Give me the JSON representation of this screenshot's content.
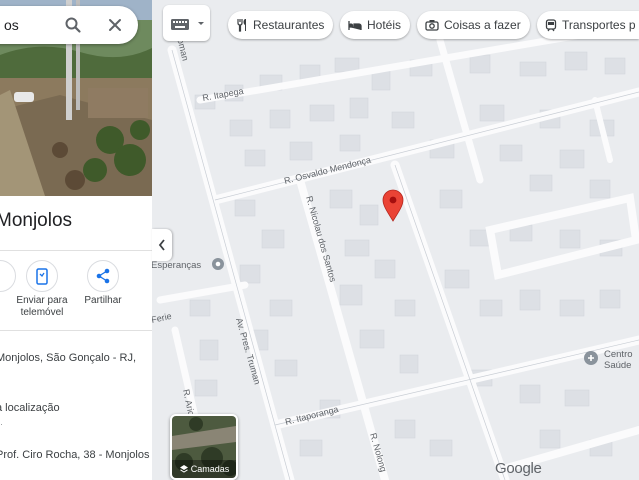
{
  "search": {
    "value": "os"
  },
  "place": {
    "title": "Monjolos",
    "actions": [
      {
        "label_line1": "",
        "label_line2": ""
      },
      {
        "label_line1": "Enviar para",
        "label_line2": "telemóvel"
      },
      {
        "label_line1": "Partilhar",
        "label_line2": ""
      }
    ],
    "address": "Monjolos, São Gonçalo - RJ,",
    "plus_code_title": "a localização",
    "plus_code_sub": "...",
    "nearby": "Prof. Ciro Rocha, 38 - Monjolos"
  },
  "filters": {
    "chips": [
      "Restaurantes",
      "Hotéis",
      "Coisas a fazer",
      "Transportes p"
    ]
  },
  "map": {
    "streets": {
      "s1": "R. Itapega",
      "s2": "R. Osvaldo Mendonça",
      "s3": "R. Nicolau dos Santos",
      "s4": "R. Itaporanga",
      "s5": "Av. Pres. Truman",
      "s6": "R. Aricaju",
      "s7": "R. Nolong",
      "s8": "R. Roman",
      "s9": "Ferie"
    },
    "pois": {
      "left": "Esperanças",
      "right_line1": "Centro",
      "right_line2": "Saúde"
    },
    "pin_color": "#ea4335",
    "layers_label": "Camadas",
    "logo": "Google"
  }
}
